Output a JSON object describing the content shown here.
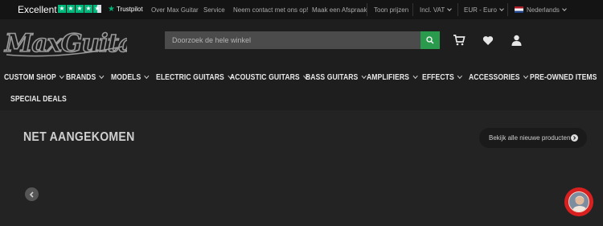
{
  "topbar": {
    "rating_text": "Excellent",
    "rating_stars": 4.5,
    "trustpilot_label": "Trustpilot",
    "links": [
      "Over Max Guitar",
      "Service",
      "Neem contact met ons op!",
      "Maak een Afspraak"
    ],
    "price_toggle": "Toon prijzen",
    "vat_select": "Incl. VAT",
    "currency_select": "EUR - Euro",
    "language_select": "Nederlands"
  },
  "header": {
    "logo_text": "Max Guitar",
    "search_placeholder": "Doorzoek de hele winkel",
    "icons": [
      "cart-icon",
      "heart-icon",
      "user-icon"
    ],
    "accent_color": "#2a9a4c"
  },
  "nav": {
    "items": [
      {
        "label": "CUSTOM SHOP",
        "dropdown": true
      },
      {
        "label": "BRANDS",
        "dropdown": true
      },
      {
        "label": "MODELS",
        "dropdown": true
      },
      {
        "label": "ELECTRIC GUITARS",
        "dropdown": true
      },
      {
        "label": "ACOUSTIC GUITARS",
        "dropdown": true
      },
      {
        "label": "BASS GUITARS",
        "dropdown": true
      },
      {
        "label": "AMPLIFIERS",
        "dropdown": true
      },
      {
        "label": "EFFECTS",
        "dropdown": true
      },
      {
        "label": "ACCESSORIES",
        "dropdown": true
      },
      {
        "label": "PRE-OWNED ITEMS",
        "dropdown": false
      },
      {
        "label": "SPECIAL DEALS",
        "dropdown": false
      }
    ]
  },
  "main": {
    "section_title": "NET AANGEKOMEN",
    "view_all_label": "Bekijk alle nieuwe producten"
  },
  "colors": {
    "background": "#232323",
    "trustpilot_green": "#00b67a",
    "chat_red": "#d82020"
  }
}
